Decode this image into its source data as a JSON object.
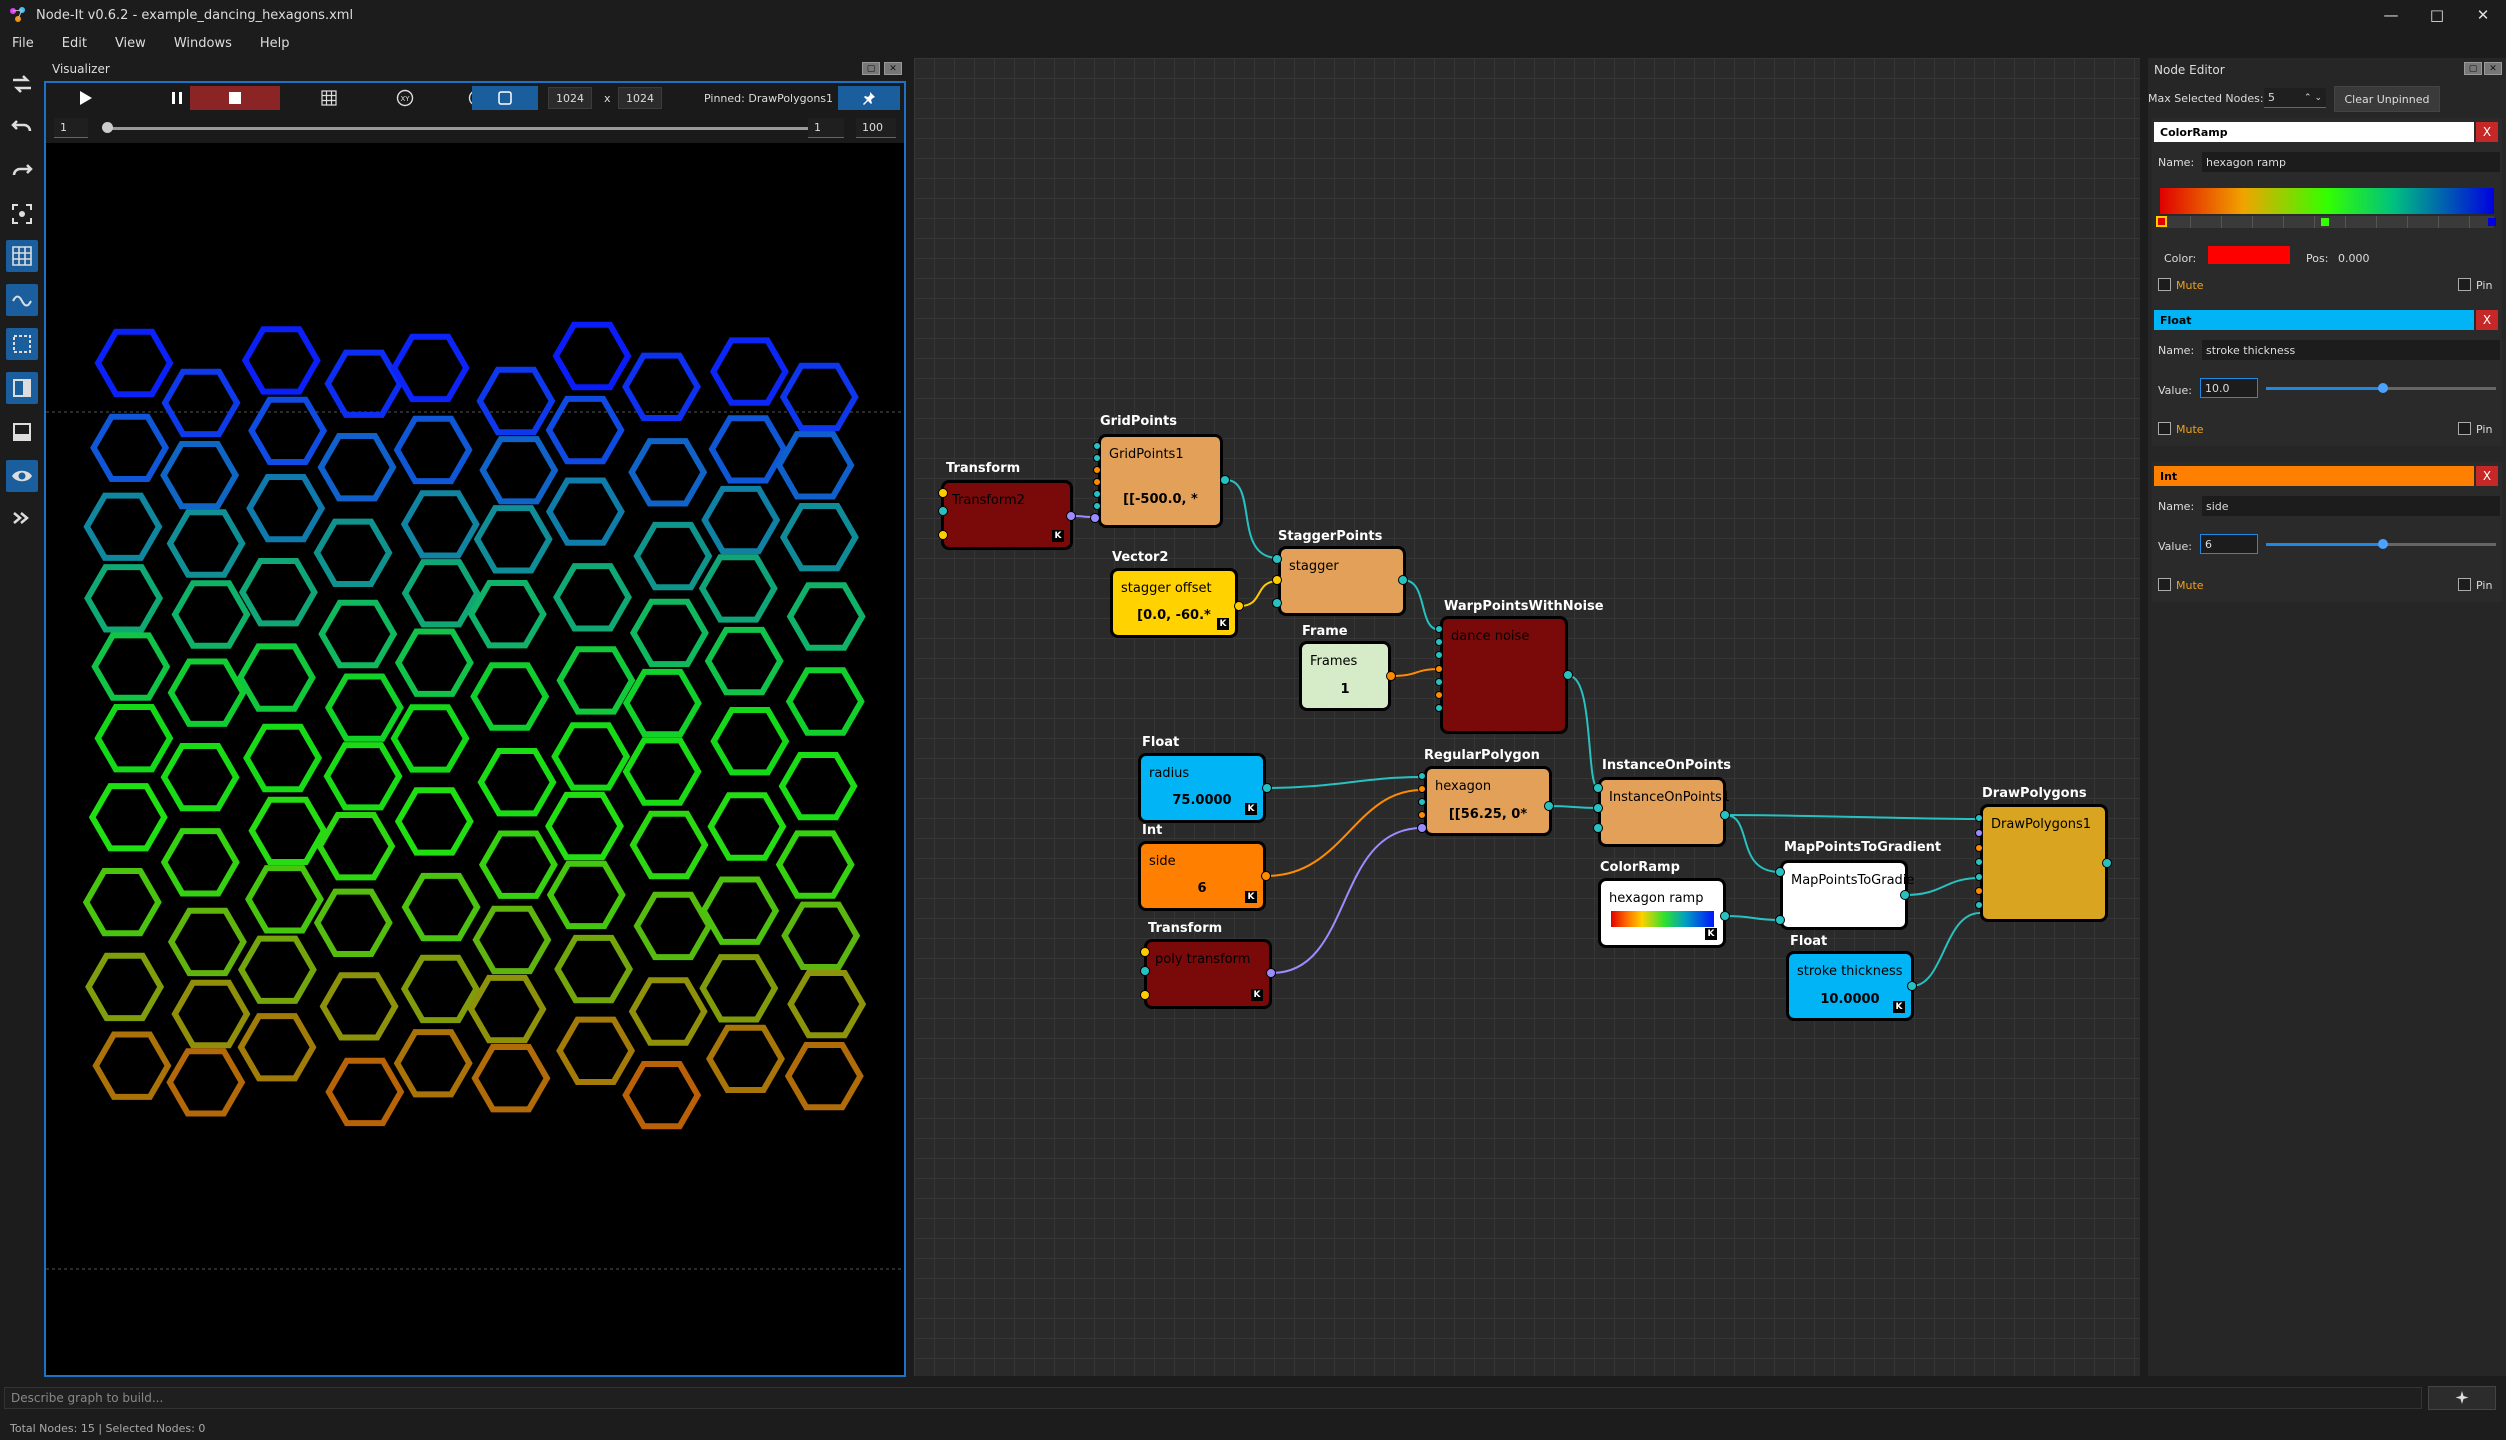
{
  "app": {
    "window_title": "Node-It v0.6.2 - example_dancing_hexagons.xml",
    "menu": [
      "File",
      "Edit",
      "View",
      "Windows",
      "Help"
    ]
  },
  "visualizer": {
    "panel_title": "Visualizer",
    "width_value": "1024",
    "times_label": "x",
    "height_value": "1024",
    "pinned_label": "Pinned: DrawPolygons1",
    "frame_start": "1",
    "frame_current": "1",
    "frame_end": "100",
    "hex_colors": [
      "#0a14ff",
      "#1050e0",
      "#108a9a",
      "#10b860",
      "#12d81a",
      "#20e012",
      "#50c010",
      "#90900a",
      "#c05a08",
      "#e81808"
    ]
  },
  "nodes": {
    "transform2": {
      "title": "Transform",
      "label": "Transform2",
      "color": "#7a0a0a"
    },
    "gridpoints": {
      "title": "GridPoints",
      "label": "GridPoints1",
      "value": "[[-500.0, *",
      "color": "#e3a059"
    },
    "staggerpoints": {
      "title": "StaggerPoints",
      "label": "stagger",
      "color": "#e3a059"
    },
    "vector2": {
      "title": "Vector2",
      "label": "stagger offset",
      "value": "[0.0, -60.*",
      "color": "#ffd200"
    },
    "frame": {
      "title": "Frame",
      "label": "Frames",
      "value": "1",
      "color": "#d6ecc9"
    },
    "warp": {
      "title": "WarpPointsWithNoise",
      "label": "dance noise",
      "color": "#7a0a0a"
    },
    "float_radius": {
      "title": "Float",
      "label": "radius",
      "value": "75.0000",
      "color": "#00b4f5"
    },
    "int_side": {
      "title": "Int",
      "label": "side",
      "value": "6",
      "color": "#ff7f00"
    },
    "transform_poly": {
      "title": "Transform",
      "label": "poly transform",
      "color": "#7a0a0a"
    },
    "regularpolygon": {
      "title": "RegularPolygon",
      "label": "hexagon",
      "value": "[[56.25, 0*",
      "color": "#e3a059"
    },
    "instanceonpoints": {
      "title": "InstanceOnPoints",
      "label": "InstanceOnPoints1",
      "color": "#e3a059"
    },
    "colorramp": {
      "title": "ColorRamp",
      "label": "hexagon ramp",
      "color": "#ffffff"
    },
    "mappoints": {
      "title": "MapPointsToGradient",
      "label": "MapPointsToGradie",
      "color": "#ffffff"
    },
    "float_stroke": {
      "title": "Float",
      "label": "stroke thickness",
      "value": "10.0000",
      "color": "#00b4f5"
    },
    "drawpolygons": {
      "title": "DrawPolygons",
      "label": "DrawPolygons1",
      "color": "#d9a520"
    }
  },
  "editor": {
    "panel_title": "Node Editor",
    "max_selected_label": "Max Selected Nodes:",
    "max_selected_value": "5",
    "clear_unpinned": "Clear Unpinned",
    "colorramp": {
      "header": "ColorRamp",
      "header_color": "#ffffff",
      "close": "X",
      "name_label": "Name:",
      "name_value": "hexagon ramp",
      "color_label": "Color:",
      "color_value": "#ff0000",
      "pos_label": "Pos:",
      "pos_value": "0.000",
      "mute": "Mute",
      "pin": "Pin"
    },
    "float": {
      "header": "Float",
      "header_color": "#00b4f5",
      "close": "X",
      "name_label": "Name:",
      "name_value": "stroke thickness",
      "value_label": "Value:",
      "value": "10.0",
      "mute": "Mute",
      "pin": "Pin",
      "slider_fraction": 0.51
    },
    "int": {
      "header": "Int",
      "header_color": "#ff7f00",
      "close": "X",
      "name_label": "Name:",
      "name_value": "side",
      "value_label": "Value:",
      "value": "6",
      "mute": "Mute",
      "pin": "Pin",
      "slider_fraction": 0.51
    }
  },
  "prompt": {
    "placeholder": "Describe graph to build..."
  },
  "status": {
    "text": "Total Nodes: 15 | Selected Nodes: 0"
  }
}
